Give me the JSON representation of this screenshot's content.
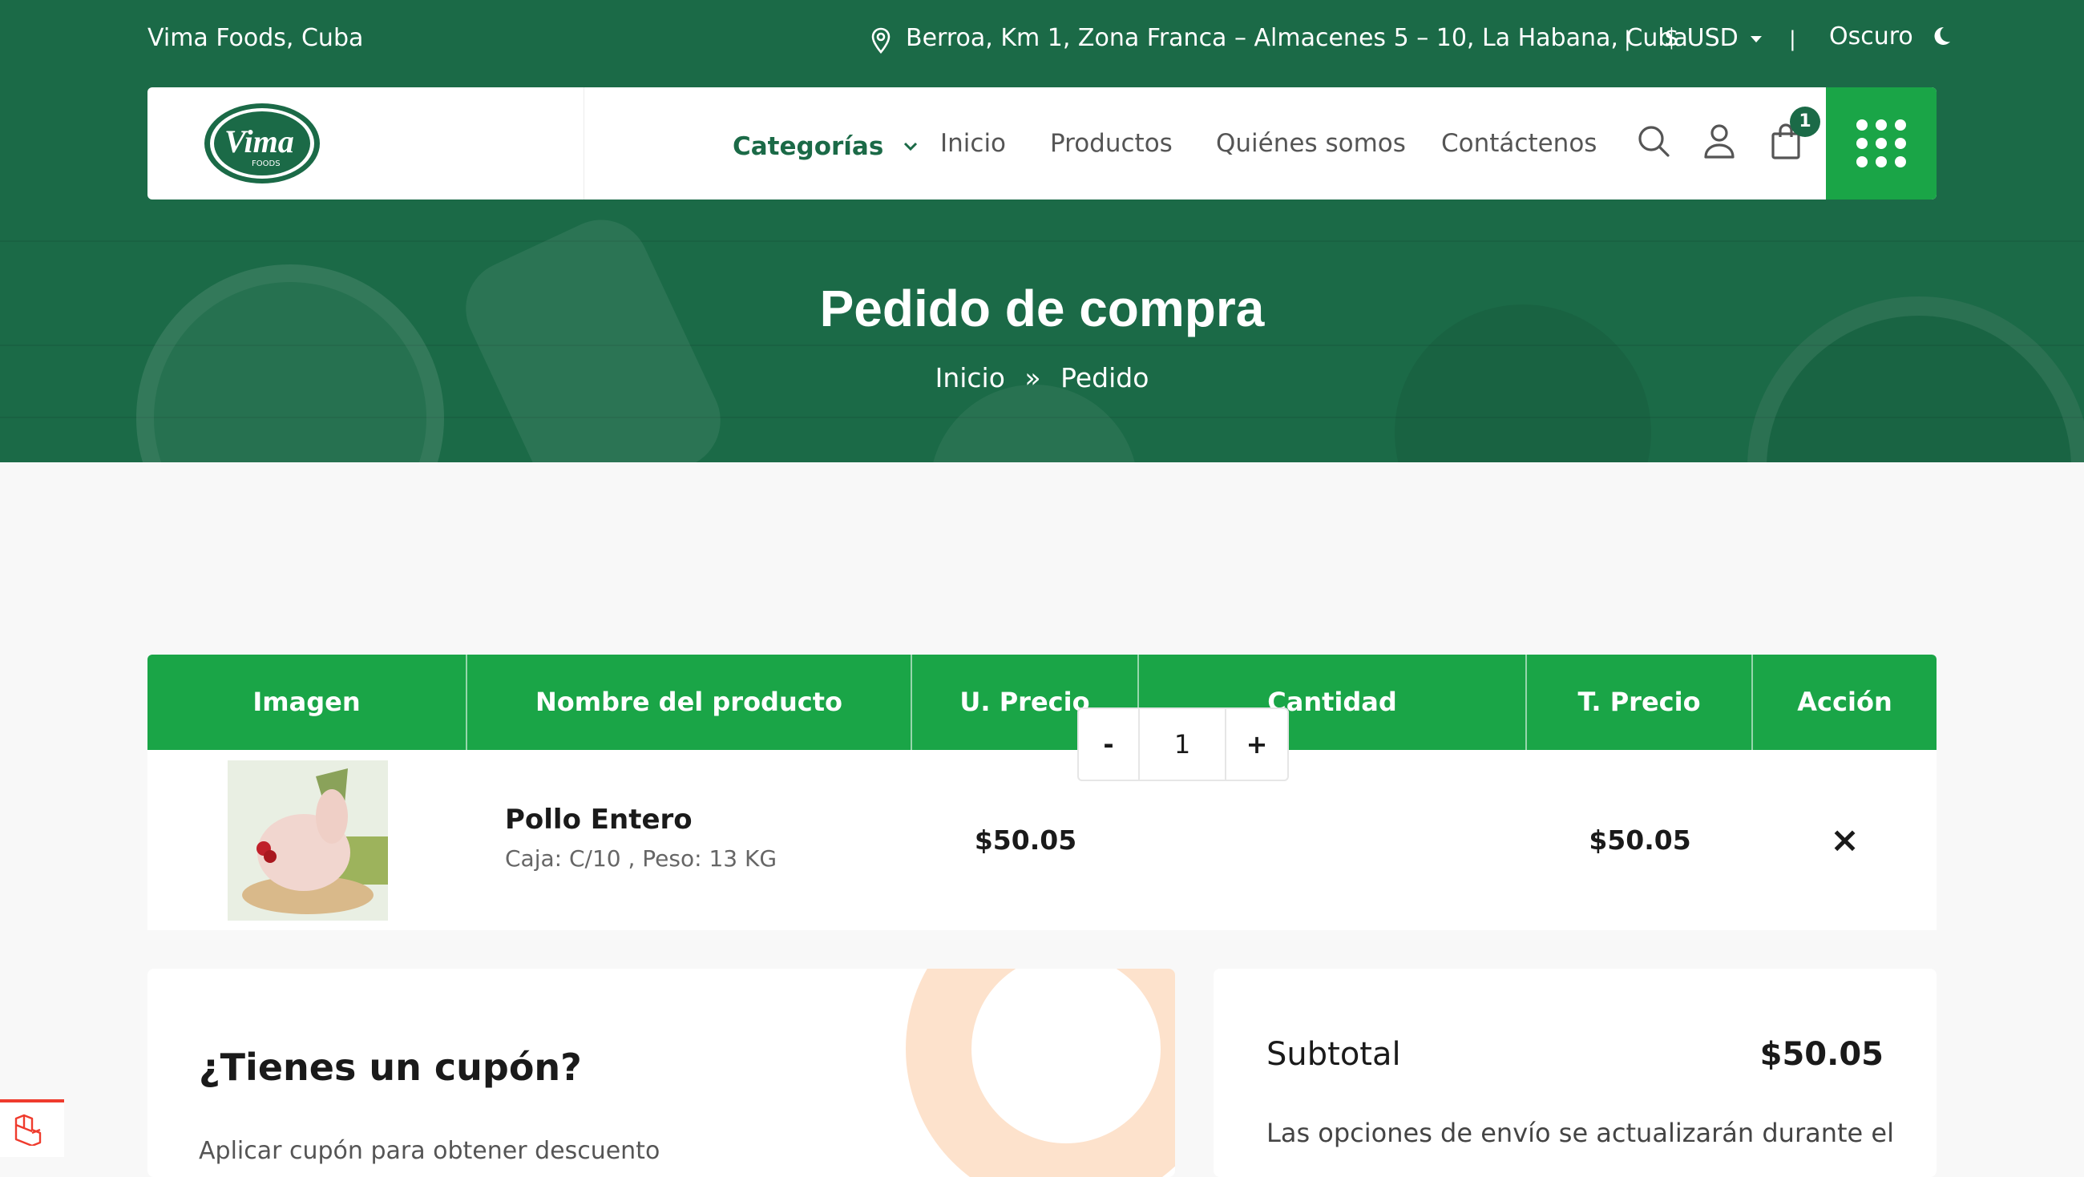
{
  "topbar": {
    "company": "Vima Foods, Cuba",
    "address": "Berroa, Km 1, Zona Franca – Almacenes 5 – 10, La Habana, Cuba",
    "currency": "$ USD",
    "theme_label": "Oscuro",
    "separator": "|"
  },
  "nav": {
    "logo_text": "Vima",
    "logo_sub": "FOODS",
    "categories": "Categorías",
    "items": [
      "Inicio",
      "Productos",
      "Quiénes somos",
      "Contáctenos"
    ],
    "cart_count": "1"
  },
  "hero": {
    "title": "Pedido de compra",
    "breadcrumb_home": "Inicio",
    "breadcrumb_sep": "»",
    "breadcrumb_current": "Pedido"
  },
  "table": {
    "headers": [
      "Imagen",
      "Nombre del producto",
      "U. Precio",
      "Cantidad",
      "T. Precio",
      "Acción"
    ],
    "rows": [
      {
        "name": "Pollo Entero",
        "details": "Caja: C/10 , Peso: 13 KG",
        "unit_price": "$50.05",
        "quantity": "1",
        "total_price": "$50.05",
        "remove": "×"
      }
    ],
    "minus": "-",
    "plus": "+"
  },
  "coupon": {
    "title": "¿Tienes un cupón?",
    "subtitle": "Aplicar cupón para obtener descuento"
  },
  "totals": {
    "subtotal_label": "Subtotal",
    "subtotal_value": "$50.05",
    "shipping_note": "Las opciones de envío se actualizarán durante el"
  },
  "colors": {
    "brand_dark": "#1b6a47",
    "brand_green": "#1aa547",
    "accent_peach": "#fde2cc"
  }
}
